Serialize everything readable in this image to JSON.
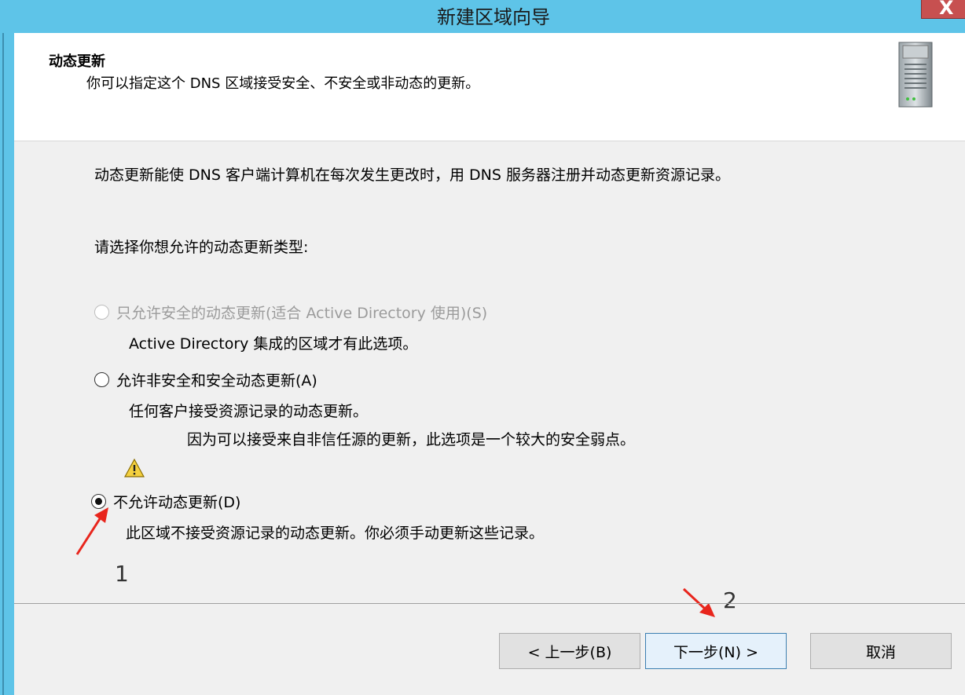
{
  "window": {
    "title": "新建区域向导",
    "close_label": "X"
  },
  "header": {
    "title": "动态更新",
    "subtitle": "你可以指定这个 DNS 区域接受安全、不安全或非动态的更新。",
    "icon": "server-icon"
  },
  "body": {
    "description": "动态更新能使 DNS 客户端计算机在每次发生更改时，用 DNS 服务器注册并动态更新资源记录。",
    "prompt": "请选择你想允许的动态更新类型:",
    "options": [
      {
        "label": "只允许安全的动态更新(适合 Active Directory 使用)(S)",
        "note": "Active Directory 集成的区域才有此选项。",
        "checked": false,
        "disabled": true
      },
      {
        "label": "允许非安全和安全动态更新(A)",
        "note": "任何客户接受资源记录的动态更新。",
        "warning": "因为可以接受来自非信任源的更新，此选项是一个较大的安全弱点。",
        "checked": false,
        "disabled": false
      },
      {
        "label": "不允许动态更新(D)",
        "note": "此区域不接受资源记录的动态更新。你必须手动更新这些记录。",
        "checked": true,
        "disabled": false
      }
    ]
  },
  "annotations": {
    "step1": "1",
    "step2": "2",
    "arrow_color": "#e8251c"
  },
  "buttons": {
    "back": "< 上一步(B)",
    "next": "下一步(N) >",
    "cancel": "取消"
  }
}
